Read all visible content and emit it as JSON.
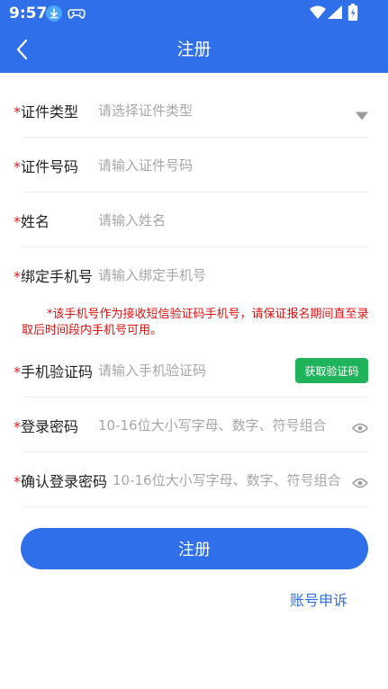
{
  "status_bar": {
    "time": "9:57",
    "icons": [
      "download-icon",
      "gamepad-icon",
      "wifi-icon",
      "signal-icon",
      "battery-icon"
    ]
  },
  "app_bar": {
    "title": "注册",
    "back_icon": "back-arrow-icon"
  },
  "form": {
    "required_mark": "*",
    "id_type": {
      "label": "证件类型",
      "placeholder": "请选择证件类型",
      "icon": "dropdown-arrow-icon"
    },
    "id_number": {
      "label": "证件号码",
      "placeholder": "请输入证件号码"
    },
    "name": {
      "label": "姓名",
      "placeholder": "请输入姓名"
    },
    "phone": {
      "label": "绑定手机号",
      "placeholder": "请输入绑定手机号"
    },
    "phone_notice": "*该手机号作为接收短信验证码手机号，请保证报名期间直至录取后时间段内手机号可用。",
    "sms_code": {
      "label": "手机验证码",
      "placeholder": "请输入手机验证码",
      "button": "获取验证码"
    },
    "password": {
      "label": "登录密码",
      "placeholder": "10-16位大小写字母、数字、符号组合",
      "icon": "eye-icon"
    },
    "confirm_password": {
      "label": "确认登录密码",
      "placeholder": "10-16位大小写字母、数字、符号组合",
      "icon": "eye-icon"
    }
  },
  "actions": {
    "register": "注册",
    "account_appeal": "账号申诉"
  },
  "colors": {
    "primary": "#2f6fea",
    "required": "#e02020",
    "code_button": "#1fb35c",
    "notice": "#e01010"
  }
}
